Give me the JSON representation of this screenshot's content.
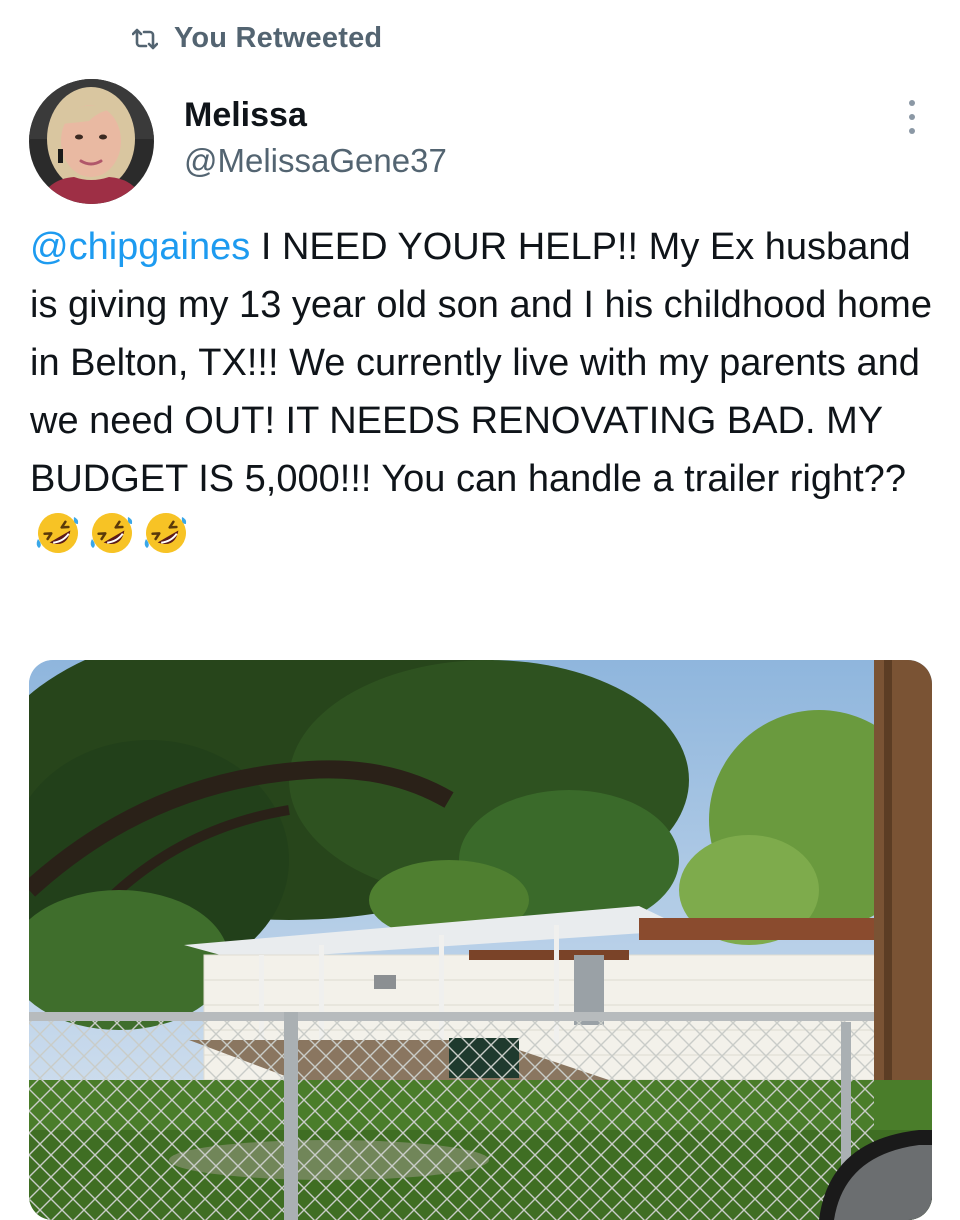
{
  "retweet": {
    "icon": "retweet-icon",
    "label": "You Retweeted"
  },
  "author": {
    "avatar": "profile-avatar",
    "name": "Melissa",
    "handle": "@MelissaGene37"
  },
  "menu": {
    "icon": "more-vertical-icon"
  },
  "tweet": {
    "mention": "@chipgaines",
    "text": " I NEED YOUR HELP!! My Ex husband is giving my 13 year old son and I his childhood home in Belton, TX!!! We currently live with my parents and we need OUT! IT NEEDS RENOVATING BAD. MY BUDGET IS 5,000!!! You can handle a trailer right?? ",
    "emojis": [
      "rolling-on-floor-laughing",
      "rolling-on-floor-laughing",
      "rolling-on-floor-laughing"
    ]
  },
  "media": {
    "content": "photo-mobile-home-behind-chain-link-fence"
  },
  "colors": {
    "mention": "#1d9bf0",
    "secondary_text": "#536471",
    "primary_text": "#0f1419"
  }
}
